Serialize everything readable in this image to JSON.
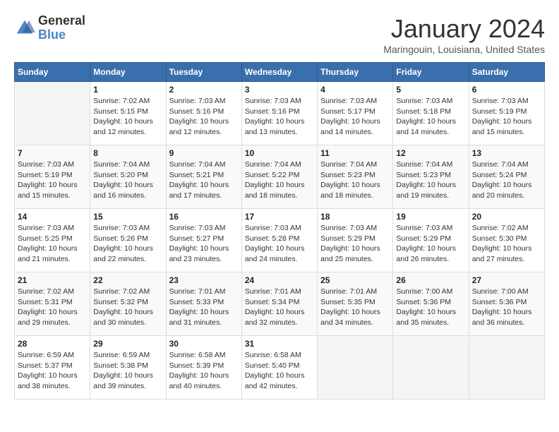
{
  "logo": {
    "line1": "General",
    "line2": "Blue"
  },
  "header": {
    "title": "January 2024",
    "location": "Maringouin, Louisiana, United States"
  },
  "weekdays": [
    "Sunday",
    "Monday",
    "Tuesday",
    "Wednesday",
    "Thursday",
    "Friday",
    "Saturday"
  ],
  "weeks": [
    [
      {
        "day": "",
        "info": ""
      },
      {
        "day": "1",
        "info": "Sunrise: 7:02 AM\nSunset: 5:15 PM\nDaylight: 10 hours\nand 12 minutes."
      },
      {
        "day": "2",
        "info": "Sunrise: 7:03 AM\nSunset: 5:16 PM\nDaylight: 10 hours\nand 12 minutes."
      },
      {
        "day": "3",
        "info": "Sunrise: 7:03 AM\nSunset: 5:16 PM\nDaylight: 10 hours\nand 13 minutes."
      },
      {
        "day": "4",
        "info": "Sunrise: 7:03 AM\nSunset: 5:17 PM\nDaylight: 10 hours\nand 14 minutes."
      },
      {
        "day": "5",
        "info": "Sunrise: 7:03 AM\nSunset: 5:18 PM\nDaylight: 10 hours\nand 14 minutes."
      },
      {
        "day": "6",
        "info": "Sunrise: 7:03 AM\nSunset: 5:19 PM\nDaylight: 10 hours\nand 15 minutes."
      }
    ],
    [
      {
        "day": "7",
        "info": "Sunrise: 7:03 AM\nSunset: 5:19 PM\nDaylight: 10 hours\nand 15 minutes."
      },
      {
        "day": "8",
        "info": "Sunrise: 7:04 AM\nSunset: 5:20 PM\nDaylight: 10 hours\nand 16 minutes."
      },
      {
        "day": "9",
        "info": "Sunrise: 7:04 AM\nSunset: 5:21 PM\nDaylight: 10 hours\nand 17 minutes."
      },
      {
        "day": "10",
        "info": "Sunrise: 7:04 AM\nSunset: 5:22 PM\nDaylight: 10 hours\nand 18 minutes."
      },
      {
        "day": "11",
        "info": "Sunrise: 7:04 AM\nSunset: 5:23 PM\nDaylight: 10 hours\nand 18 minutes."
      },
      {
        "day": "12",
        "info": "Sunrise: 7:04 AM\nSunset: 5:23 PM\nDaylight: 10 hours\nand 19 minutes."
      },
      {
        "day": "13",
        "info": "Sunrise: 7:04 AM\nSunset: 5:24 PM\nDaylight: 10 hours\nand 20 minutes."
      }
    ],
    [
      {
        "day": "14",
        "info": "Sunrise: 7:03 AM\nSunset: 5:25 PM\nDaylight: 10 hours\nand 21 minutes."
      },
      {
        "day": "15",
        "info": "Sunrise: 7:03 AM\nSunset: 5:26 PM\nDaylight: 10 hours\nand 22 minutes."
      },
      {
        "day": "16",
        "info": "Sunrise: 7:03 AM\nSunset: 5:27 PM\nDaylight: 10 hours\nand 23 minutes."
      },
      {
        "day": "17",
        "info": "Sunrise: 7:03 AM\nSunset: 5:28 PM\nDaylight: 10 hours\nand 24 minutes."
      },
      {
        "day": "18",
        "info": "Sunrise: 7:03 AM\nSunset: 5:29 PM\nDaylight: 10 hours\nand 25 minutes."
      },
      {
        "day": "19",
        "info": "Sunrise: 7:03 AM\nSunset: 5:29 PM\nDaylight: 10 hours\nand 26 minutes."
      },
      {
        "day": "20",
        "info": "Sunrise: 7:02 AM\nSunset: 5:30 PM\nDaylight: 10 hours\nand 27 minutes."
      }
    ],
    [
      {
        "day": "21",
        "info": "Sunrise: 7:02 AM\nSunset: 5:31 PM\nDaylight: 10 hours\nand 29 minutes."
      },
      {
        "day": "22",
        "info": "Sunrise: 7:02 AM\nSunset: 5:32 PM\nDaylight: 10 hours\nand 30 minutes."
      },
      {
        "day": "23",
        "info": "Sunrise: 7:01 AM\nSunset: 5:33 PM\nDaylight: 10 hours\nand 31 minutes."
      },
      {
        "day": "24",
        "info": "Sunrise: 7:01 AM\nSunset: 5:34 PM\nDaylight: 10 hours\nand 32 minutes."
      },
      {
        "day": "25",
        "info": "Sunrise: 7:01 AM\nSunset: 5:35 PM\nDaylight: 10 hours\nand 34 minutes."
      },
      {
        "day": "26",
        "info": "Sunrise: 7:00 AM\nSunset: 5:36 PM\nDaylight: 10 hours\nand 35 minutes."
      },
      {
        "day": "27",
        "info": "Sunrise: 7:00 AM\nSunset: 5:36 PM\nDaylight: 10 hours\nand 36 minutes."
      }
    ],
    [
      {
        "day": "28",
        "info": "Sunrise: 6:59 AM\nSunset: 5:37 PM\nDaylight: 10 hours\nand 38 minutes."
      },
      {
        "day": "29",
        "info": "Sunrise: 6:59 AM\nSunset: 5:38 PM\nDaylight: 10 hours\nand 39 minutes."
      },
      {
        "day": "30",
        "info": "Sunrise: 6:58 AM\nSunset: 5:39 PM\nDaylight: 10 hours\nand 40 minutes."
      },
      {
        "day": "31",
        "info": "Sunrise: 6:58 AM\nSunset: 5:40 PM\nDaylight: 10 hours\nand 42 minutes."
      },
      {
        "day": "",
        "info": ""
      },
      {
        "day": "",
        "info": ""
      },
      {
        "day": "",
        "info": ""
      }
    ]
  ]
}
